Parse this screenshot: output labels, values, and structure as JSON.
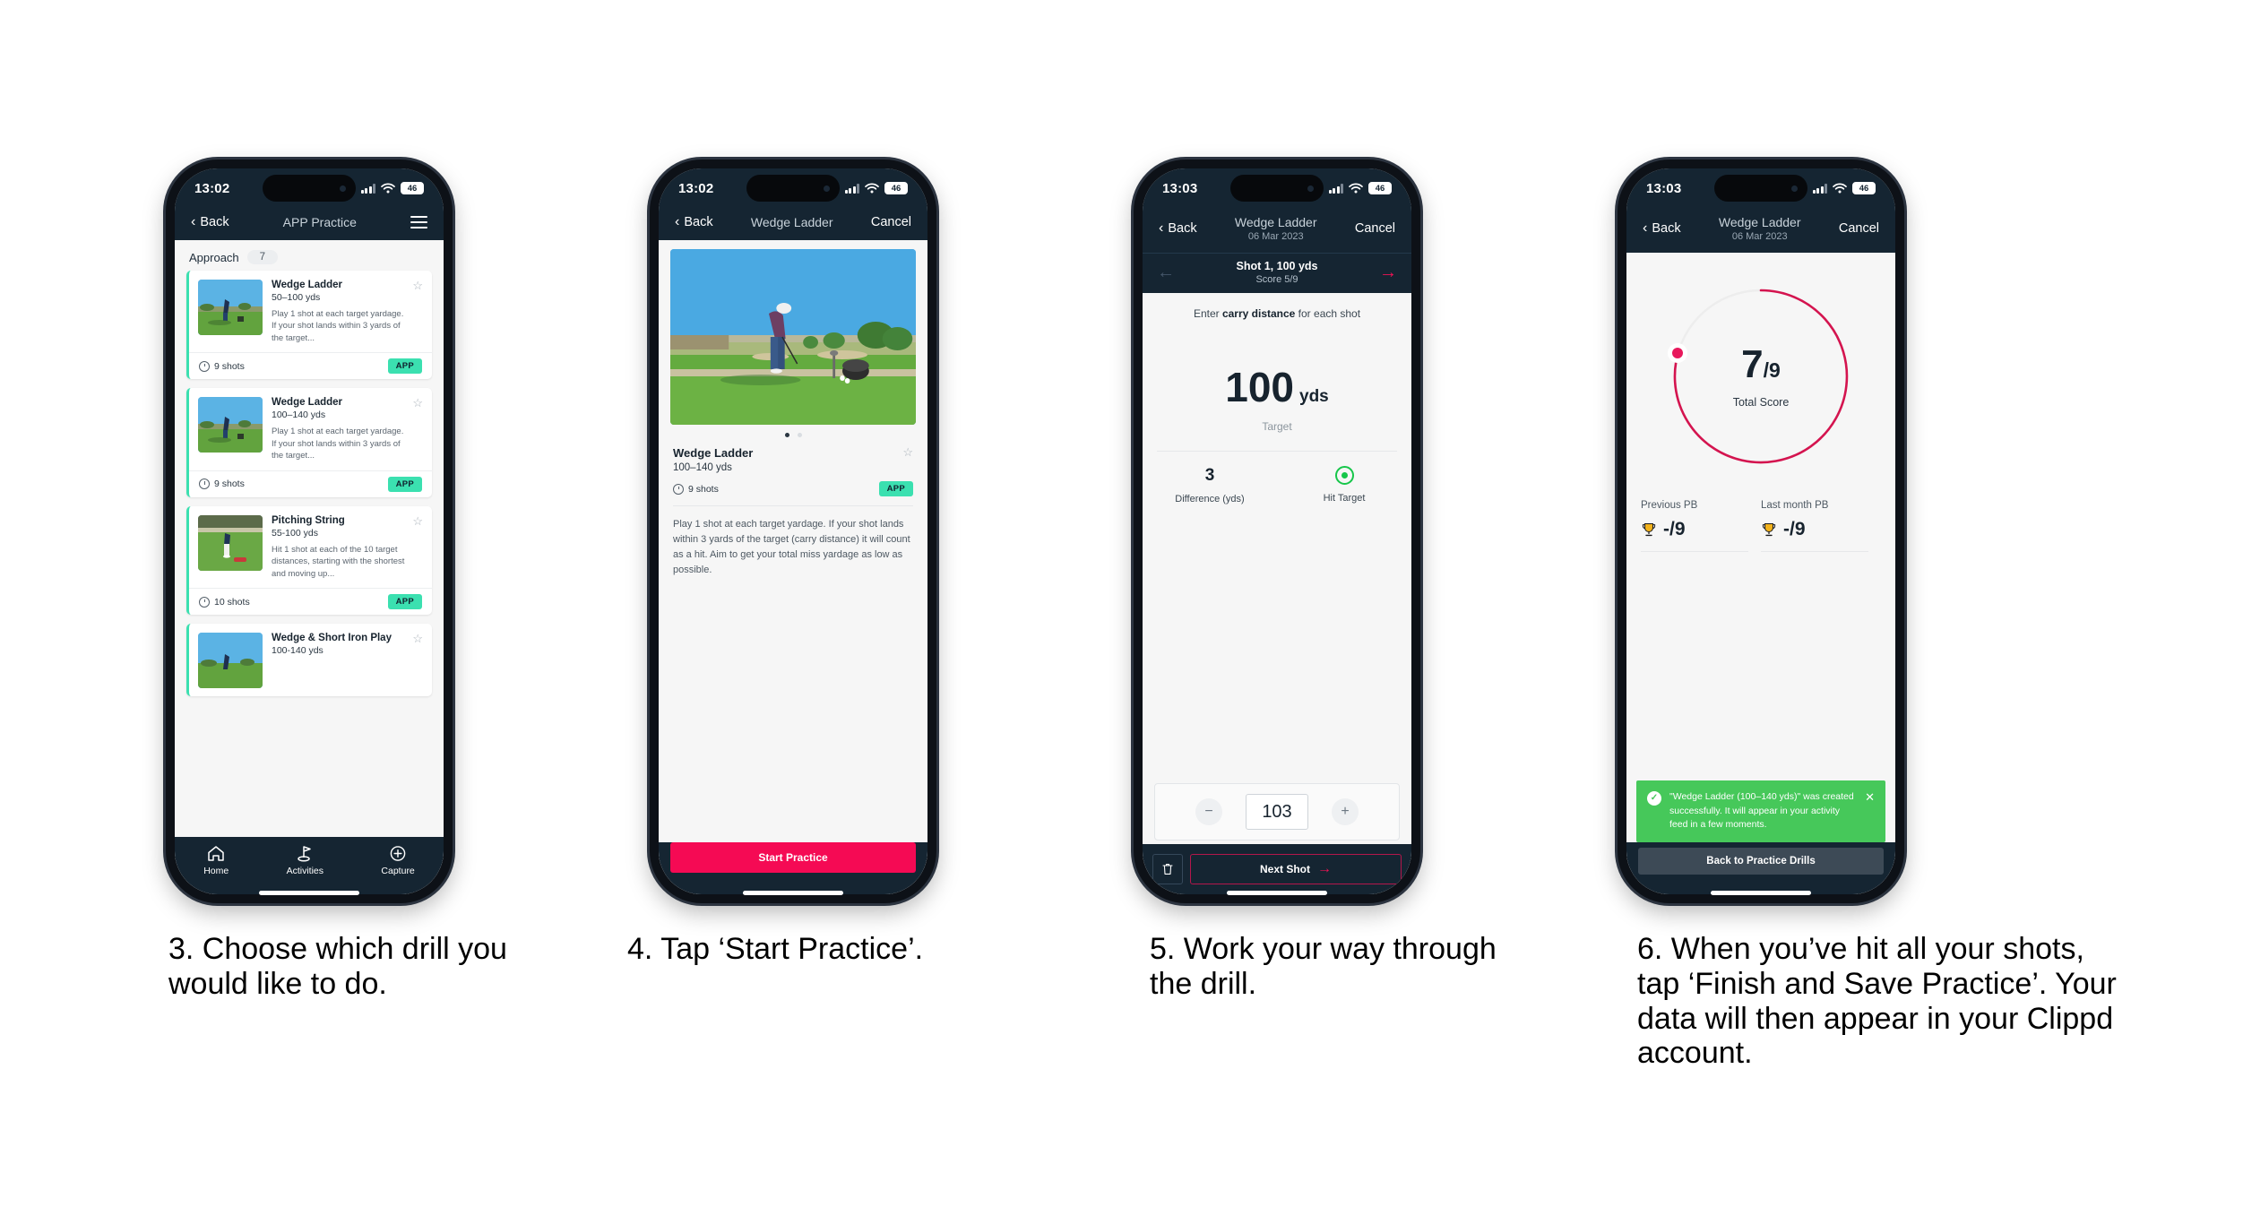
{
  "statusbar": {
    "time_a": "13:02",
    "time_b": "13:03",
    "battery": "46"
  },
  "phone1": {
    "nav": {
      "back": "Back",
      "title": "APP Practice",
      "menu_icon": "hamburger-icon"
    },
    "section": {
      "name": "Approach",
      "count": "7"
    },
    "cards": [
      {
        "title": "Wedge Ladder",
        "sub": "50–100 yds",
        "desc": "Play 1 shot at each target yardage. If your shot lands within 3 yards of the target...",
        "shots": "9 shots",
        "badge": "APP"
      },
      {
        "title": "Wedge Ladder",
        "sub": "100–140 yds",
        "desc": "Play 1 shot at each target yardage. If your shot lands within 3 yards of the target...",
        "shots": "9 shots",
        "badge": "APP"
      },
      {
        "title": "Pitching String",
        "sub": "55-100 yds",
        "desc": "Hit 1 shot at each of the 10 target distances, starting with the shortest and moving up...",
        "shots": "10 shots",
        "badge": "APP"
      },
      {
        "title": "Wedge & Short Iron Play",
        "sub": "100-140 yds",
        "desc": "",
        "shots": "",
        "badge": ""
      }
    ],
    "tabs": [
      {
        "label": "Home",
        "icon": "home-icon"
      },
      {
        "label": "Activities",
        "icon": "golf-flag-icon"
      },
      {
        "label": "Capture",
        "icon": "plus-circle-icon"
      }
    ]
  },
  "phone2": {
    "nav": {
      "back": "Back",
      "title": "Wedge Ladder",
      "cancel": "Cancel"
    },
    "detail": {
      "title": "Wedge Ladder",
      "sub": "100–140 yds",
      "shots": "9 shots",
      "badge": "APP",
      "desc": "Play 1 shot at each target yardage. If your shot lands within 3 yards of the target (carry distance) it will count as a hit. Aim to get your total miss yardage as low as possible."
    },
    "cta": "Start Practice"
  },
  "phone3": {
    "nav": {
      "back": "Back",
      "title": "Wedge Ladder",
      "subtitle": "06 Mar 2023",
      "cancel": "Cancel"
    },
    "shotbar": {
      "line1": "Shot 1, 100 yds",
      "line2": "Score 5/9"
    },
    "prompt_pre": "Enter ",
    "prompt_bold": "carry distance",
    "prompt_post": " for each shot",
    "target": {
      "value": "100",
      "unit": "yds",
      "label": "Target"
    },
    "stats": [
      {
        "value": "3",
        "label": "Difference (yds)"
      },
      {
        "value": "",
        "label": "Hit Target"
      }
    ],
    "stepper": {
      "minus": "−",
      "value": "103",
      "plus": "+"
    },
    "footer": {
      "delete_icon": "trash-icon",
      "next": "Next Shot"
    }
  },
  "phone4": {
    "nav": {
      "back": "Back",
      "title": "Wedge Ladder",
      "subtitle": "06 Mar 2023",
      "cancel": "Cancel"
    },
    "score": {
      "value": "7",
      "total": "/9",
      "label": "Total Score"
    },
    "pbs": [
      {
        "label": "Previous PB",
        "value": "-/9",
        "icon": "trophy-icon"
      },
      {
        "label": "Last month PB",
        "value": "-/9",
        "icon": "trophy-icon"
      }
    ],
    "toast": {
      "text": "\"Wedge Ladder (100–140 yds)\" was created successfully. It will appear in your activity feed in a few moments.",
      "check_icon": "check-circle-icon",
      "close_icon": "close-icon"
    },
    "button": "Back to Practice Drills"
  },
  "captions": {
    "c3": "3. Choose which drill you would like to do.",
    "c4": "4. Tap ‘Start Practice’.",
    "c5": "5. Work your way through the drill.",
    "c6": "6. When you’ve hit all your shots, tap ‘Finish and Save Practice’. Your data will then appear in your Clippd account."
  },
  "colors": {
    "pink": "#f50a54",
    "teal": "#3be0b0",
    "navy": "#152532",
    "green": "#46c85a"
  }
}
